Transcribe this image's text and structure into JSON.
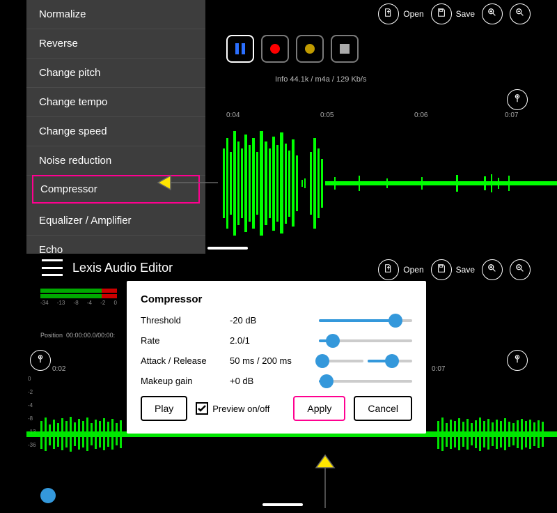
{
  "menu": {
    "items": [
      {
        "label": "Normalize"
      },
      {
        "label": "Reverse"
      },
      {
        "label": "Change pitch"
      },
      {
        "label": "Change tempo"
      },
      {
        "label": "Change speed"
      },
      {
        "label": "Noise reduction"
      },
      {
        "label": "Compressor"
      },
      {
        "label": "Equalizer / Amplifier"
      },
      {
        "label": "Echo"
      }
    ]
  },
  "toolbar": {
    "open_label": "Open",
    "save_label": "Save"
  },
  "info": {
    "line": "Info   44.1k / m4a / 129 Kb/s"
  },
  "ruler_top": {
    "ticks": [
      "0:04",
      "0:05",
      "0:06",
      "0:07"
    ]
  },
  "app_title": "Lexis Audio Editor",
  "vu": {
    "labels": [
      "-34",
      "-13",
      "-8",
      "-4",
      "-2",
      "0"
    ]
  },
  "position": {
    "label_prefix": "Position",
    "value": "00:00:00.0/00:00:"
  },
  "ruler_bot_left": {
    "tick": "0:02"
  },
  "ruler_bot_right": {
    "ticks": [
      "0:07"
    ]
  },
  "scale": {
    "marks": [
      "0",
      "-2",
      "-4",
      "-8",
      "-13",
      "-36"
    ]
  },
  "dialog": {
    "title": "Compressor",
    "threshold_label": "Threshold",
    "threshold_value": "-20 dB",
    "rate_label": "Rate",
    "rate_value": "2.0/1",
    "attack_label": "Attack / Release",
    "attack_value": "50 ms   /   200 ms",
    "makeup_label": "Makeup gain",
    "makeup_value": "+0 dB",
    "play_label": "Play",
    "preview_label": "Preview on/off",
    "apply_label": "Apply",
    "cancel_label": "Cancel"
  },
  "colors": {
    "accent": "#3498db",
    "highlight": "#ff0090",
    "wave": "#00ff00"
  }
}
